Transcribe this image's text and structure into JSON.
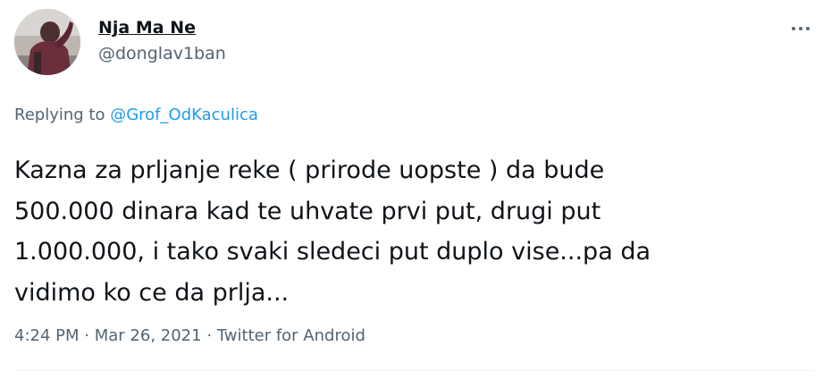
{
  "tweet": {
    "author": {
      "display_name": "Nja Ma Ne",
      "handle": "@donglav1ban"
    },
    "reply": {
      "prefix": "Replying to",
      "target": "@Grof_OdKaculica"
    },
    "text": "Kazna za prljanje reke ( prirode uopste ) da bude\n500.000 dinara kad te uhvate prvi put, drugi put\n1.000.000, i tako svaki sledeci put duplo vise...pa da\nvidimo ko ce da prlja...",
    "meta": {
      "time": "4:24 PM",
      "separator": "·",
      "date": "Mar 26, 2021",
      "source": "Twitter for Android"
    },
    "more_icon": "more-horizontal-icon"
  },
  "colors": {
    "text_primary": "#0f1419",
    "text_secondary": "#536471",
    "accent": "#1d9bf0",
    "divider": "#eff3f4"
  }
}
